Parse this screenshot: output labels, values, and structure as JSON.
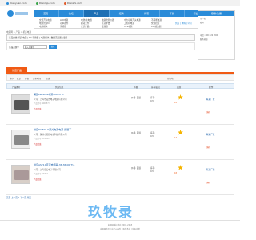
{
  "topbar": {
    "sites": [
      {
        "label": "Dianyuan.com",
        "color": "#2a8bd8"
      },
      {
        "label": "Dianluju.com",
        "color": "#3aa54a"
      },
      {
        "label": "Dianzhi.com",
        "color": "#e25b2a"
      }
    ]
  },
  "nav": {
    "items": [
      "首页",
      "论坛",
      "产品",
      "招聘",
      "博客",
      "下载",
      "行业会",
      "技术问答"
    ]
  },
  "subnav": {
    "col1": [
      "交流开关电源",
      "电源管理IC",
      "电源模块"
    ],
    "col2": [
      "LED电源",
      "功率器件",
      "传感器"
    ],
    "col3": [
      "电池/充电器",
      "被动元件",
      "光伏产品"
    ],
    "col4": [
      "电源检测仪器",
      "无功补偿",
      "变频器"
    ],
    "col5": [
      "中大功率开关电源",
      "工控机电源",
      "UPS电源"
    ],
    "col6": [
      "不间断电源",
      "交流稳压",
      "EMI滤波器"
    ],
    "extra": "供应 | 求购 | 公司"
  },
  "right_panel": {
    "title": "登录/注册",
    "lines": [
      "用户名",
      "密码",
      "电话: 400 822 2000",
      "服务热线"
    ]
  },
  "breadcrumb": "电源网 > 产品 > 机床电源",
  "filterbar": "产品分类: 机床电源 | DC 转换器 | 电源模块 | 数据采集器 | 更多",
  "search": {
    "label": "产品关键字",
    "placeholder": "输入关键字",
    "button": "搜索"
  },
  "tab": {
    "label": "供应产品"
  },
  "sort": {
    "labels": [
      "排序:",
      "默认",
      "价格",
      "发布时间",
      "在线"
    ],
    "region": "所在地"
  },
  "table_head": [
    "产品图片",
    "供应信息",
    "价格",
    "库存/起订",
    "资质",
    "操作"
  ],
  "rows": [
    {
      "name": "美国Lambda电源900-57.5",
      "company": "公司：上海市凌志电子电源有限公司",
      "line": "产品型号 900-57.5",
      "tag": "产品信息",
      "price": "价格: 面议",
      "stock": "库存:",
      "stock2": "1PC",
      "badge": "12",
      "action": "联系厂家",
      "action2": "询价"
    },
    {
      "name": "供应DC800-5开关电源电源-报警下",
      "company": "公司：深圳市英赛电子科技有限公司",
      "line": "产品型号 DC800-5",
      "tag": "产品信息",
      "price": "价格: 面议",
      "stock": "库存:",
      "stock2": "1PC",
      "badge": "17",
      "action": "联系厂家",
      "action2": "询价"
    },
    {
      "name": "供应AST10直流电源输-36-36-00(T)4",
      "company": "公司：上海宝石电子有限公司",
      "line": "产品型号 AST10",
      "tag": "产品信息",
      "price": "价格: 面议",
      "stock": "库存:",
      "stock2": "1PC",
      "badge": "18",
      "action": "联系厂家",
      "action2": "询价"
    }
  ],
  "pager": "首页  上一页  1  下一页  尾页",
  "footer": {
    "line1": "电源网版权所有 2003-2015",
    "line2": "电源网首页 | 电子元器件 | 服务条款 | 隐私政策"
  },
  "watermark": "玖牧录"
}
